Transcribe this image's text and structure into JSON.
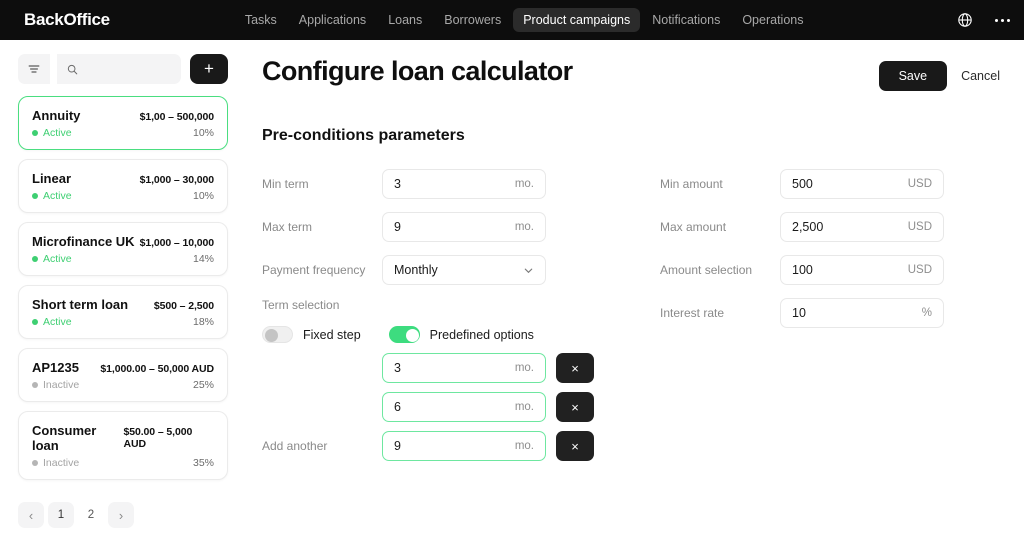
{
  "topbar": {
    "brand": "BackOffice",
    "nav": [
      {
        "label": "Tasks",
        "active": false
      },
      {
        "label": "Applications",
        "active": false
      },
      {
        "label": "Loans",
        "active": false
      },
      {
        "label": "Borrowers",
        "active": false
      },
      {
        "label": "Product campaigns",
        "active": true
      },
      {
        "label": "Notifications",
        "active": false
      },
      {
        "label": "Operations",
        "active": false
      }
    ],
    "globe_icon": "globe-icon",
    "more_icon": "more-options-icon"
  },
  "sidebar": {
    "filter_icon": "filter-icon",
    "search": {
      "value": "",
      "placeholder": ""
    },
    "add_label": "+",
    "campaigns": [
      {
        "name": "Annuity",
        "range": "$1,00 – 500,000",
        "status": "Active",
        "rate": "10%",
        "selected": true
      },
      {
        "name": "Linear",
        "range": "$1,000 – 30,000",
        "status": "Active",
        "rate": "10%",
        "selected": false
      },
      {
        "name": "Microfinance UK",
        "range": "$1,000 – 10,000",
        "status": "Active",
        "rate": "14%",
        "selected": false
      },
      {
        "name": "Short term loan",
        "range": "$500 – 2,500",
        "status": "Active",
        "rate": "18%",
        "selected": false
      },
      {
        "name": "AP1235",
        "range": "$1,000.00 – 50,000 AUD",
        "status": "Inactive",
        "rate": "25%",
        "selected": false
      },
      {
        "name": "Consumer loan",
        "range": "$50.00 – 5,000 AUD",
        "status": "Inactive",
        "rate": "35%",
        "selected": false
      }
    ],
    "pagination": {
      "prev_icon": "chevron-left-icon",
      "next_icon": "chevron-right-icon",
      "pages": [
        "1",
        "2"
      ],
      "current": "1"
    }
  },
  "main": {
    "title": "Configure loan calculator",
    "save_label": "Save",
    "cancel_label": "Cancel",
    "section_title": "Pre-conditions parameters",
    "left_fields": [
      {
        "label": "Min term",
        "value": "3",
        "suffix": "mo."
      },
      {
        "label": "Max term",
        "value": "9",
        "suffix": "mo."
      }
    ],
    "payment_frequency": {
      "label": "Payment frequency",
      "value": "Monthly",
      "chevron_icon": "chevron-down-icon"
    },
    "right_fields": [
      {
        "label": "Min amount",
        "value": "500",
        "suffix": "USD"
      },
      {
        "label": "Max amount",
        "value": "2,500",
        "suffix": "USD"
      },
      {
        "label": "Amount selection",
        "value": "100",
        "suffix": "USD"
      },
      {
        "label": "Interest rate",
        "value": "10",
        "suffix": "%"
      }
    ],
    "term_selection": {
      "label": "Term selection",
      "fixed_step": {
        "label": "Fixed step",
        "on": false
      },
      "predefined": {
        "label": "Predefined options",
        "on": true
      },
      "add_another_label": "Add another",
      "remove_label": "×",
      "options": [
        {
          "value": "3",
          "suffix": "mo."
        },
        {
          "value": "6",
          "suffix": "mo."
        },
        {
          "value": "9",
          "suffix": "mo."
        }
      ]
    }
  },
  "colors": {
    "accent_green": "#3ddc7f",
    "nav_bg": "#0d0d0d",
    "dark_button": "#191919",
    "status_active": "#3ecf72",
    "status_inactive": "#a3a3a3"
  }
}
